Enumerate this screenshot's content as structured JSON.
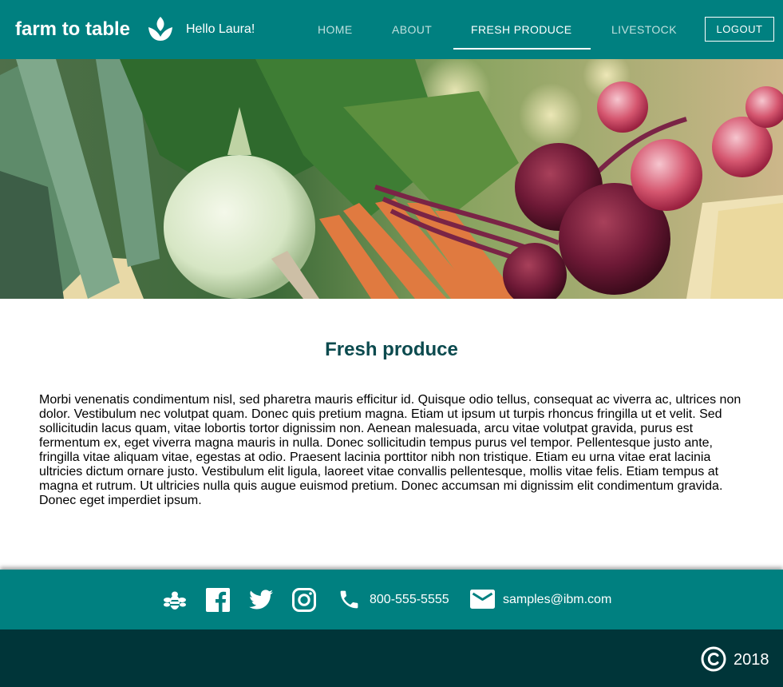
{
  "header": {
    "brand": "farm to table",
    "greeting": "Hello Laura!",
    "nav": [
      "HOME",
      "ABOUT",
      "FRESH PRODUCE",
      "LIVESTOCK"
    ],
    "active_nav": "FRESH PRODUCE",
    "logout_label": "LOGOUT",
    "logo_icon": "sprout-icon"
  },
  "hero": {
    "icon": "vegetables-banner-image"
  },
  "main": {
    "title": "Fresh produce",
    "body": "Morbi venenatis condimentum nisl, sed pharetra mauris efficitur id. Quisque odio tellus, consequat ac viverra ac, ultrices non dolor. Vestibulum nec volutpat quam. Donec quis pretium magna. Etiam ut ipsum ut turpis rhoncus fringilla ut et velit. Sed sollicitudin lacus quam, vitae lobortis tortor dignissim non. Aenean malesuada, arcu vitae volutpat gravida, purus est fermentum ex, eget viverra magna mauris in nulla. Donec sollicitudin tempus purus vel tempor. Pellentesque justo ante, fringilla vitae aliquam vitae, egestas at odio. Praesent lacinia porttitor nibh non tristique. Etiam eu urna vitae erat lacinia ultricies dictum ornare justo. Vestibulum elit ligula, laoreet vitae convallis pellentesque, mollis vitae felis. Etiam tempus at magna et rutrum. Ut ultricies nulla quis augue euismod pretium. Donec accumsan mi dignissim elit condimentum gravida. Donec eget imperdiet ipsum."
  },
  "footer": {
    "icons": [
      "bee-icon",
      "facebook-icon",
      "twitter-icon",
      "instagram-icon",
      "phone-icon",
      "mail-icon",
      "copyright-icon"
    ],
    "phone": "800-555-5555",
    "email": "samples@ibm.com",
    "year": "2018"
  },
  "colors": {
    "teal": "#008080",
    "dark_teal": "#003539",
    "title": "#0b4a4e",
    "nav_inactive": "#bfe0de"
  }
}
